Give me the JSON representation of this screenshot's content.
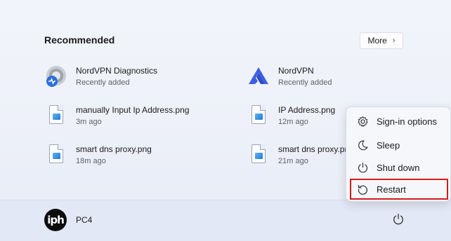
{
  "recommended": {
    "title": "Recommended",
    "more_label": "More",
    "items": [
      {
        "name": "NordVPN Diagnostics",
        "sub": "Recently added",
        "icon": "nordvpn-diagnostics-icon"
      },
      {
        "name": "NordVPN",
        "sub": "Recently added",
        "icon": "nordvpn-icon"
      },
      {
        "name": "manually Input Ip Address.png",
        "sub": "3m ago",
        "icon": "png-file-icon"
      },
      {
        "name": "IP Address.png",
        "sub": "12m ago",
        "icon": "png-file-icon"
      },
      {
        "name": "smart dns proxy.png",
        "sub": "18m ago",
        "icon": "png-file-icon"
      },
      {
        "name": "smart dns proxy.png",
        "sub": "21m ago",
        "icon": "png-file-icon"
      }
    ]
  },
  "power_menu": {
    "items": [
      {
        "label": "Sign-in options",
        "icon": "gear-icon"
      },
      {
        "label": "Sleep",
        "icon": "moon-icon"
      },
      {
        "label": "Shut down",
        "icon": "power-icon"
      },
      {
        "label": "Restart",
        "icon": "restart-icon"
      }
    ],
    "highlight_color": "#d51a1a"
  },
  "user": {
    "name": "PC4",
    "avatar_text": "iph"
  }
}
